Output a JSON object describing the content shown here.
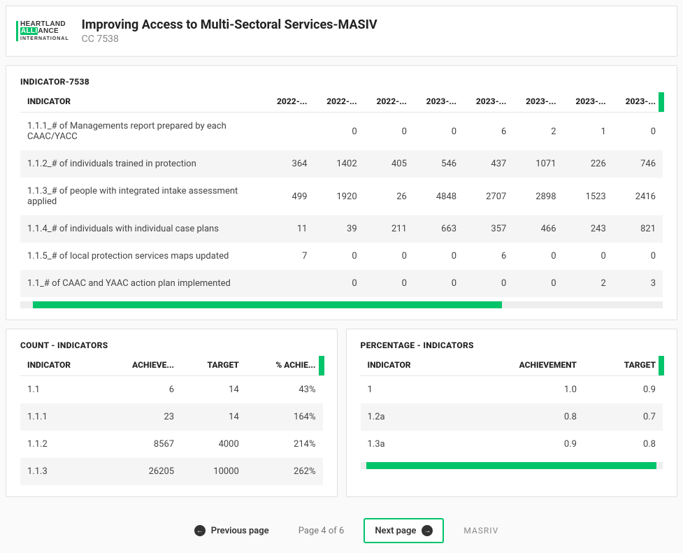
{
  "header": {
    "logo": {
      "line1": "HEARTLAND",
      "line2a": "ALLI",
      "line2b": "ANCE",
      "line3": "INTERNATIONAL"
    },
    "title": "Improving Access to Multi-Sectoral Services-MASIV",
    "subtitle": "CC 7538"
  },
  "main_table": {
    "title": "INDICATOR-7538",
    "columns": [
      "INDICATOR",
      "2022-...",
      "2022-...",
      "2022-...",
      "2023-...",
      "2023-...",
      "2023-...",
      "2023-...",
      "2023-..."
    ],
    "rows": [
      {
        "indicator": "1.1.1_# of Managements report prepared by each CAAC/YACC",
        "values": [
          "",
          "0",
          "0",
          "0",
          "6",
          "2",
          "1",
          "0"
        ]
      },
      {
        "indicator": "1.1.2_# of individuals trained in protection",
        "values": [
          "364",
          "1402",
          "405",
          "546",
          "437",
          "1071",
          "226",
          "746"
        ]
      },
      {
        "indicator": "1.1.3_# of people with integrated intake assessment applied",
        "values": [
          "499",
          "1920",
          "26",
          "4848",
          "2707",
          "2898",
          "1523",
          "2416"
        ]
      },
      {
        "indicator": "1.1.4_# of individuals with individual case plans",
        "values": [
          "11",
          "39",
          "211",
          "663",
          "357",
          "466",
          "243",
          "821"
        ]
      },
      {
        "indicator": "1.1.5_# of local protection services maps updated",
        "values": [
          "7",
          "0",
          "0",
          "0",
          "6",
          "0",
          "0",
          "0"
        ]
      },
      {
        "indicator": "1.1_# of CAAC and YAAC action plan implemented",
        "values": [
          "",
          "0",
          "0",
          "0",
          "0",
          "0",
          "2",
          "3"
        ]
      }
    ]
  },
  "count_table": {
    "title": "COUNT - INDICATORS",
    "columns": [
      "INDICATOR",
      "ACHIEVE...",
      "TARGET",
      "% ACHIE..."
    ],
    "rows": [
      {
        "indicator": "1.1",
        "achievement": "6",
        "target": "14",
        "pct": "43%"
      },
      {
        "indicator": "1.1.1",
        "achievement": "23",
        "target": "14",
        "pct": "164%"
      },
      {
        "indicator": "1.1.2",
        "achievement": "8567",
        "target": "4000",
        "pct": "214%"
      },
      {
        "indicator": "1.1.3",
        "achievement": "26205",
        "target": "10000",
        "pct": "262%"
      }
    ]
  },
  "percent_table": {
    "title": "PERCENTAGE - INDICATORS",
    "columns": [
      "INDICATOR",
      "ACHIEVEMENT",
      "TARGET"
    ],
    "rows": [
      {
        "indicator": "1",
        "achievement": "1.0",
        "target": "0.9"
      },
      {
        "indicator": "1.2a",
        "achievement": "0.8",
        "target": "0.7"
      },
      {
        "indicator": "1.3a",
        "achievement": "0.9",
        "target": "0.8"
      }
    ]
  },
  "footer": {
    "prev": "Previous page",
    "page": "Page 4 of 6",
    "next": "Next page",
    "brand": "MASRIV"
  },
  "colors": {
    "accent": "#00c36a"
  }
}
